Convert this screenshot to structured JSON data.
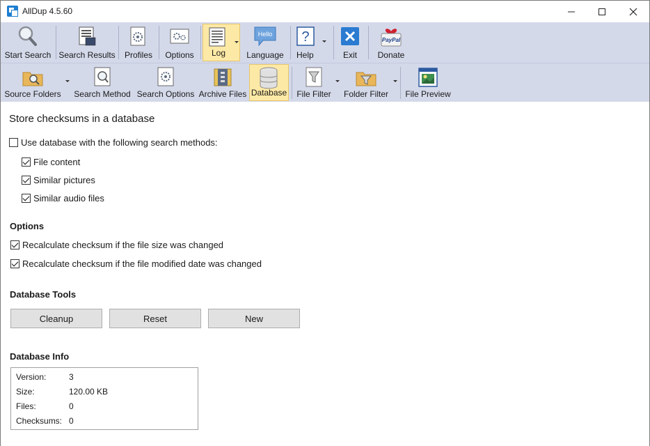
{
  "window": {
    "title": "AllDup 4.5.60"
  },
  "toolbar1": {
    "items": [
      {
        "label": "Start Search",
        "icon": "magnifier-icon"
      },
      {
        "label": "Search Results",
        "icon": "results-icon"
      },
      {
        "label": "Profiles",
        "icon": "profiles-icon"
      },
      {
        "label": "Options",
        "icon": "options-icon"
      },
      {
        "label": "Log",
        "icon": "log-icon"
      },
      {
        "label": "Language",
        "icon": "language-icon"
      },
      {
        "label": "Help",
        "icon": "help-icon"
      },
      {
        "label": "Exit",
        "icon": "exit-icon"
      },
      {
        "label": "Donate",
        "icon": "paypal-icon"
      }
    ],
    "hello_text": "Hello",
    "paypal_text": "PayPal"
  },
  "toolbar2": {
    "items": [
      {
        "label": "Source Folders",
        "icon": "source-folders-icon"
      },
      {
        "label": "Search Method",
        "icon": "search-method-icon"
      },
      {
        "label": "Search Options",
        "icon": "search-options-icon"
      },
      {
        "label": "Archive Files",
        "icon": "archive-files-icon"
      },
      {
        "label": "Database",
        "icon": "database-icon"
      },
      {
        "label": "File Filter",
        "icon": "file-filter-icon"
      },
      {
        "label": "Folder Filter",
        "icon": "folder-filter-icon"
      },
      {
        "label": "File Preview",
        "icon": "file-preview-icon"
      }
    ]
  },
  "main": {
    "heading": "Store checksums in a database",
    "use_db": {
      "label": "Use database with the following search methods:",
      "checked": false
    },
    "methods": [
      {
        "label": "File content",
        "checked": true
      },
      {
        "label": "Similar pictures",
        "checked": true
      },
      {
        "label": "Similar audio files",
        "checked": true
      }
    ],
    "options_title": "Options",
    "options": [
      {
        "label": "Recalculate checksum if the file size was changed",
        "checked": true
      },
      {
        "label": "Recalculate checksum if the file modified date was changed",
        "checked": true
      }
    ],
    "tools_title": "Database Tools",
    "tools": {
      "cleanup": "Cleanup",
      "reset": "Reset",
      "new": "New"
    },
    "info_title": "Database Info",
    "info": [
      {
        "key": "Version:",
        "value": "3"
      },
      {
        "key": "Size:",
        "value": "120.00 KB"
      },
      {
        "key": "Files:",
        "value": "0"
      },
      {
        "key": "Checksums:",
        "value": "0"
      }
    ]
  }
}
